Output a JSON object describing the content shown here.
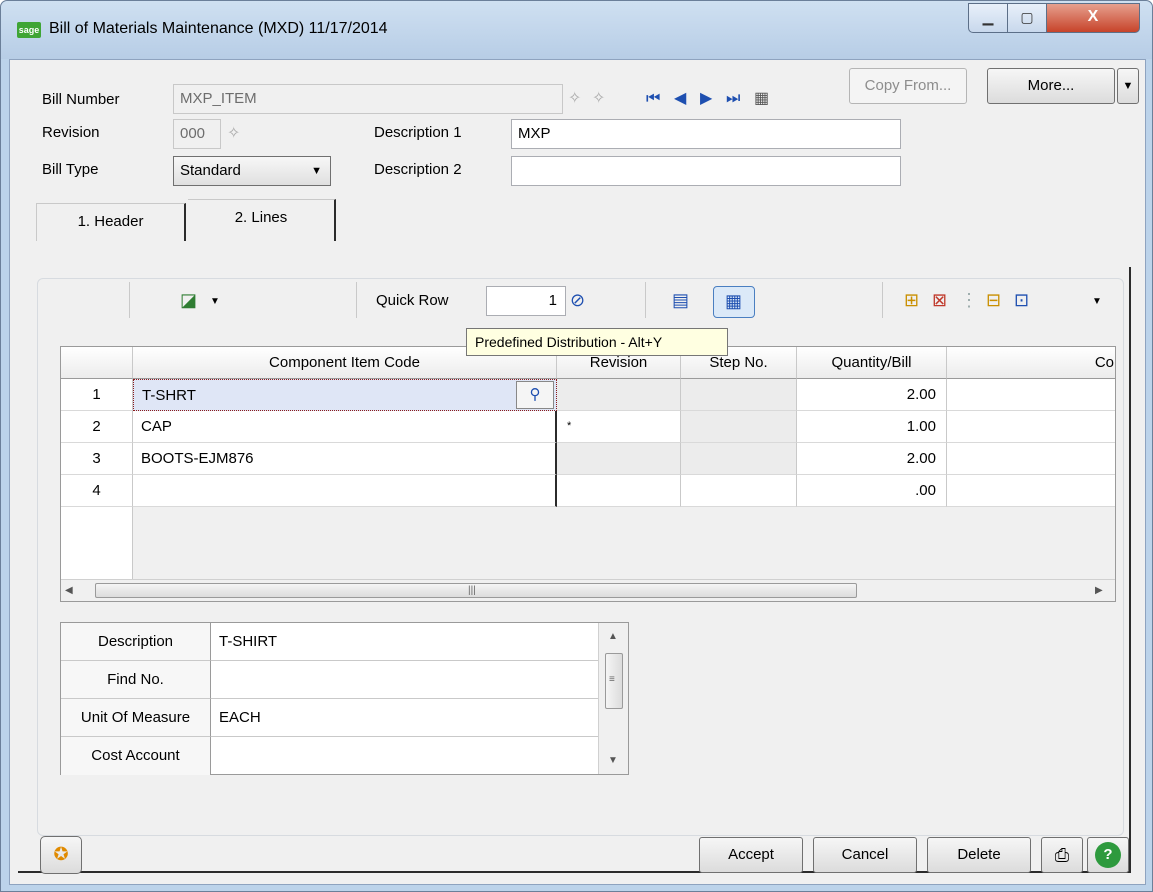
{
  "window": {
    "app_icon_text": "sage",
    "title": "Bill of Materials Maintenance (MXD) 11/17/2014",
    "controls": {
      "minimize": "▁",
      "maximize": "▢",
      "close": "X"
    }
  },
  "header": {
    "bill_number_label": "Bill Number",
    "bill_number_value": "MXP_ITEM",
    "revision_label": "Revision",
    "revision_value": "000",
    "bill_type_label": "Bill Type",
    "bill_type_value": "Standard",
    "description1_label": "Description 1",
    "description1_value": "MXP",
    "description2_label": "Description 2",
    "description2_value": "",
    "copy_from_label": "Copy From...",
    "more_label": "More..."
  },
  "tabs": [
    {
      "label": "1. Header",
      "active": false
    },
    {
      "label": "2. Lines",
      "active": true
    }
  ],
  "toolbar": {
    "quick_row_label": "Quick Row",
    "quick_row_value": "1"
  },
  "tooltip": "Predefined Distribution - Alt+Y",
  "grid": {
    "columns": [
      "",
      "Component Item Code",
      "Revision",
      "Step No.",
      "Quantity/Bill",
      "Co"
    ],
    "rows": [
      {
        "n": "1",
        "code": "T-SHRT",
        "revision": "",
        "step": "",
        "qty": "2.00"
      },
      {
        "n": "2",
        "code": "CAP",
        "revision": "*",
        "step": "",
        "qty": "1.00"
      },
      {
        "n": "3",
        "code": "BOOTS-EJM876",
        "revision": "",
        "step": "",
        "qty": "2.00"
      },
      {
        "n": "4",
        "code": "",
        "revision": "",
        "step": "",
        "qty": ".00"
      }
    ]
  },
  "detail": {
    "rows": [
      {
        "label": "Description",
        "value": "T-SHIRT"
      },
      {
        "label": "Find No.",
        "value": ""
      },
      {
        "label": "Unit Of Measure",
        "value": "EACH"
      },
      {
        "label": "Cost Account",
        "value": ""
      }
    ]
  },
  "footer": {
    "accept_label": "Accept",
    "cancel_label": "Cancel",
    "delete_label": "Delete"
  },
  "colors": {
    "accent": "#1e4fb0",
    "tooltip_bg": "#ffffe1",
    "close_red": "#c7432a"
  }
}
